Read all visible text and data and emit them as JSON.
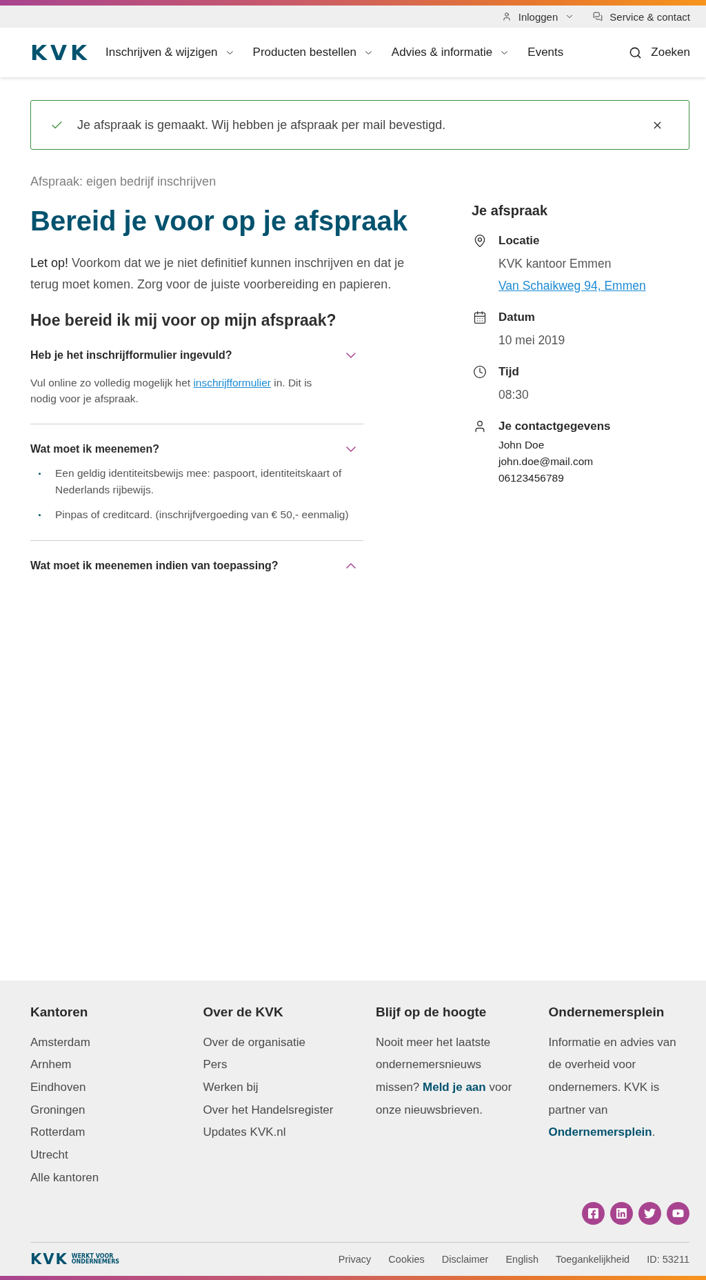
{
  "top_bar": {
    "links": [
      {
        "kind": "account",
        "label": "Inloggen"
      },
      {
        "kind": "service",
        "label": "Service & contact"
      }
    ]
  },
  "header": {
    "logo": "KVK",
    "nav": [
      {
        "label": "Inschrijven & wijzigen",
        "kind": "menu"
      },
      {
        "label": "Producten bestellen",
        "kind": "menu"
      },
      {
        "label": "Advies & informatie",
        "kind": "menu"
      },
      {
        "label": "Events",
        "kind": "link"
      }
    ],
    "search": {
      "label": "Zoeken"
    }
  },
  "alert": {
    "kind": "success",
    "message": "Je afspraak is gemaakt. Wij hebben je afspraak per mail bevestigd."
  },
  "main": {
    "subtitle": "Afspraak: eigen bedrijf inschrijven",
    "title": "Bereid je voor op je afspraak",
    "intro": "**Let op!** Voorkom dat we je niet definitief kunnen inschrijven en dat je terug moet komen. Zorg voor de juiste voorbereiding en papieren.",
    "section_title": "Hoe bereid ik mij voor op mijn afspraak?",
    "accordion": [
      {
        "title": "Heb je het inschrijfformulier ingevuld?",
        "expanded": true,
        "content": {
          "kind": "text",
          "text_before": "Vul online zo volledig mogelijk het ",
          "link": "inschrijfformulier",
          "text_after": " in. Dit is nodig voor je afspraak."
        }
      },
      {
        "title": "Wat moet ik meenemen?",
        "expanded": true,
        "content": {
          "kind": "list",
          "items": [
            "Een geldig identiteitsbewijs mee: paspoort, identiteitskaart of Nederlands rijbewijs.",
            "Pinpas of creditcard. (inschrijfvergoeding van € 50,- eenmalig)"
          ]
        }
      },
      {
        "title": "Wat moet ik meenemen indien van toepassing?",
        "expanded": false
      }
    ]
  },
  "appointment": {
    "title": "Je afspraak",
    "items": [
      {
        "kind": "location",
        "label": "Locatie",
        "lines": [
          {
            "text": "KVK kantoor Emmen",
            "link": false
          },
          {
            "text": "Van Schaikweg 94, Emmen",
            "link": true
          }
        ]
      },
      {
        "kind": "date",
        "label": "Datum",
        "lines": [
          {
            "text": "10 mei 2019",
            "link": false
          }
        ]
      },
      {
        "kind": "time",
        "label": "Tijd",
        "lines": [
          {
            "text": "08:30",
            "link": false
          }
        ]
      },
      {
        "kind": "contact",
        "label": "Je contactgegevens",
        "lines": [
          {
            "text": "John Doe",
            "link": false
          },
          {
            "text": "john.doe@mail.com",
            "link": false
          },
          {
            "text": "06123456789",
            "link": false
          }
        ]
      }
    ]
  },
  "footer": {
    "columns": [
      {
        "title": "Kantoren",
        "kind": "links",
        "links": [
          "Amsterdam",
          "Arnhem",
          "Eindhoven",
          "Groningen",
          "Rotterdam",
          "Utrecht",
          "Alle kantoren"
        ]
      },
      {
        "title": "Over de KVK",
        "kind": "links",
        "links": [
          "Over de organisatie",
          "Pers",
          "Werken bij",
          "Over het Handelsregister",
          "Updates KVK.nl"
        ]
      },
      {
        "title": "Blijf op de hoogte",
        "kind": "text",
        "text_before": "Nooit meer het laatste ondernemersnieuws missen? ",
        "link": "Meld je aan",
        "text_after": " voor onze nieuwsbrieven."
      },
      {
        "title": "Ondernemersplein",
        "kind": "text",
        "text_before": "Informatie en advies van de overheid voor ondernemers. KVK is partner van ",
        "link": "Ondernemersplein",
        "text_after": "."
      }
    ],
    "bottom": {
      "logo": "KVK",
      "tagline": [
        "WERKT VOOR",
        "ONDERNEMERS"
      ],
      "links": [
        "Privacy",
        "Cookies",
        "Disclaimer",
        "English",
        "Toegankelijkheid"
      ],
      "id": "ID: 53211"
    }
  }
}
